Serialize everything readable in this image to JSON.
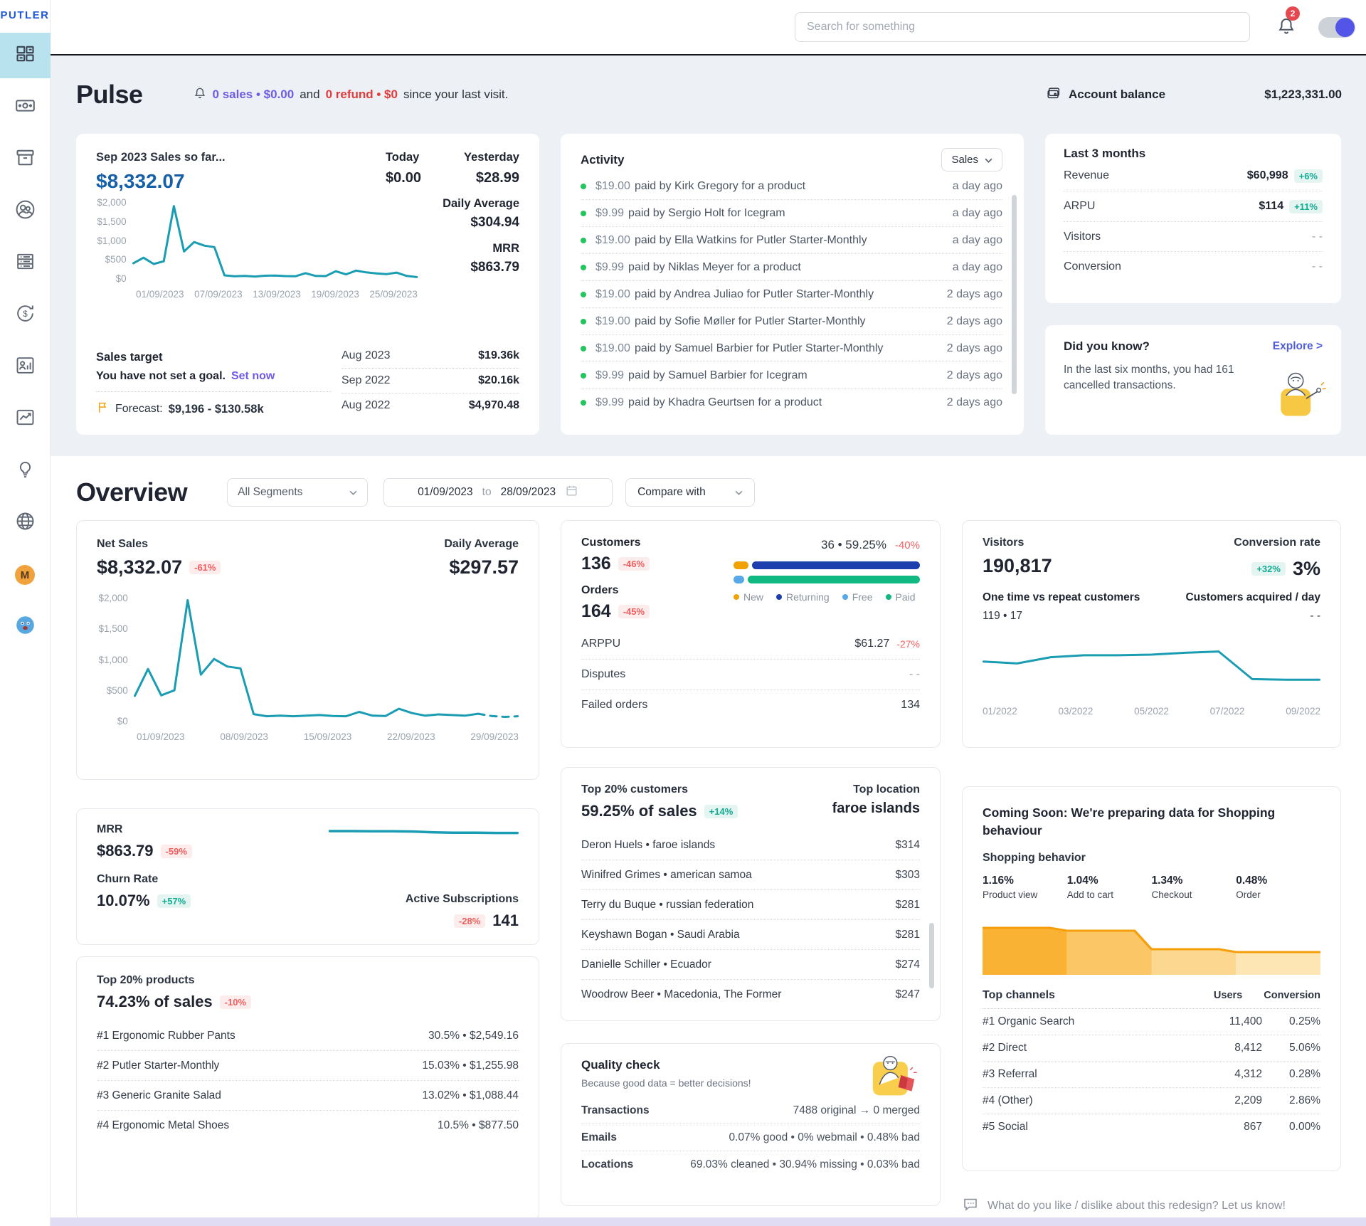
{
  "sidebar": {
    "logo": "PUTLER",
    "profile_initial": "M"
  },
  "topbar": {
    "search_placeholder": "Search for something",
    "notification_count": "2"
  },
  "pulse": {
    "title": "Pulse",
    "notice": {
      "sales": "0 sales • $0.00",
      "and": "and",
      "refund": "0 refund • $0",
      "suffix": "since your last visit."
    },
    "account_balance": {
      "label": "Account balance",
      "value": "$1,223,331.00"
    },
    "sales_card": {
      "title": "Sep 2023 Sales so far...",
      "amount": "$8,332.07",
      "today_label": "Today",
      "today_value": "$0.00",
      "yesterday_label": "Yesterday",
      "yesterday_value": "$28.99",
      "daily_avg_label": "Daily Average",
      "daily_avg_value": "$304.94",
      "mrr_label": "MRR",
      "mrr_value": "$863.79",
      "target_title": "Sales target",
      "target_text": "You have not set a goal.",
      "target_link": "Set now",
      "forecast_label": "Forecast:",
      "forecast_value": "$9,196 - $130.58k",
      "history": [
        {
          "label": "Aug 2023",
          "value": "$19.36k"
        },
        {
          "label": "Sep 2022",
          "value": "$20.16k"
        },
        {
          "label": "Aug 2022",
          "value": "$4,970.48"
        }
      ],
      "chart": {
        "type": "line",
        "ymax": 2000,
        "y_ticks": [
          "$2,000",
          "$1,500",
          "$1,000",
          "$500",
          "$0"
        ],
        "x_ticks": [
          "01/09/2023",
          "07/09/2023",
          "13/09/2023",
          "19/09/2023",
          "25/09/2023"
        ],
        "values": [
          420,
          560,
          400,
          470,
          1880,
          720,
          960,
          870,
          830,
          110,
          85,
          95,
          80,
          100,
          105,
          90,
          85,
          165,
          95,
          90,
          215,
          135,
          230,
          185,
          160,
          140,
          180,
          95,
          65
        ]
      }
    },
    "activity": {
      "title": "Activity",
      "filter_label": "Sales",
      "items": [
        {
          "amount": "$19.00",
          "text": "paid by Kirk Gregory for a product",
          "time": "a day ago"
        },
        {
          "amount": "$9.99",
          "text": "paid by Sergio Holt for Icegram",
          "time": "a day ago"
        },
        {
          "amount": "$19.00",
          "text": "paid by Ella Watkins for Putler Starter-Monthly",
          "time": "a day ago"
        },
        {
          "amount": "$9.99",
          "text": "paid by Niklas Meyer for a product",
          "time": "a day ago"
        },
        {
          "amount": "$19.00",
          "text": "paid by Andrea Juliao for Putler Starter-Monthly",
          "time": "2 days ago"
        },
        {
          "amount": "$19.00",
          "text": "paid by Sofie Møller for Putler Starter-Monthly",
          "time": "2 days ago"
        },
        {
          "amount": "$19.00",
          "text": "paid by Samuel Barbier for Putler Starter-Monthly",
          "time": "2 days ago"
        },
        {
          "amount": "$9.99",
          "text": "paid by Samuel Barbier for Icegram",
          "time": "2 days ago"
        },
        {
          "amount": "$9.99",
          "text": "paid by Khadra Geurtsen for a product",
          "time": "2 days ago"
        }
      ]
    },
    "last3": {
      "title": "Last 3 months",
      "rows": [
        {
          "label": "Revenue",
          "value": "$60,998",
          "change": "+6%"
        },
        {
          "label": "ARPU",
          "value": "$114",
          "change": "+11%"
        },
        {
          "label": "Visitors",
          "value": "- -"
        },
        {
          "label": "Conversion",
          "value": "- -"
        }
      ]
    },
    "didyouknow": {
      "title": "Did you know?",
      "link": "Explore >",
      "text": "In the last six months, you had 161 cancelled transactions."
    }
  },
  "overview": {
    "title": "Overview",
    "segments_label": "All Segments",
    "date_from": "01/09/2023",
    "date_join": "to",
    "date_to": "28/09/2023",
    "compare_label": "Compare with",
    "net_sales": {
      "title": "Net Sales",
      "amount": "$8,332.07",
      "change": "-61%",
      "daily_avg_label": "Daily Average",
      "daily_avg_value": "$297.57",
      "chart": {
        "type": "line",
        "ymax": 2000,
        "dashed_from": 26,
        "y_ticks": [
          "$2,000",
          "$1,500",
          "$1,000",
          "$500",
          "$0"
        ],
        "x_ticks": [
          "01/09/2023",
          "08/09/2023",
          "15/09/2023",
          "22/09/2023",
          "29/09/2023"
        ],
        "values": [
          420,
          850,
          430,
          510,
          1950,
          760,
          1010,
          890,
          860,
          130,
          95,
          105,
          95,
          105,
          115,
          100,
          95,
          165,
          105,
          100,
          215,
          145,
          105,
          125,
          115,
          105,
          135,
          100,
          85,
          95
        ]
      }
    },
    "mrr": {
      "title": "MRR",
      "amount": "$863.79",
      "change": "-59%",
      "churn_label": "Churn Rate",
      "churn_value": "10.07%",
      "churn_change": "+57%",
      "subs_label": "Active Subscriptions",
      "subs_change": "-28%",
      "subs_value": "141",
      "spark": {
        "type": "line",
        "ymax": 100,
        "values": [
          82,
          82,
          81,
          81,
          80,
          76,
          74,
          74,
          73,
          73
        ]
      }
    },
    "top_products": {
      "title": "Top 20% products",
      "share": "74.23% of sales",
      "change": "-10%",
      "rows": [
        {
          "name": "#1 Ergonomic Rubber Pants",
          "stats": "30.5% • $2,549.16"
        },
        {
          "name": "#2 Putler Starter-Monthly",
          "stats": "15.03% • $1,255.98"
        },
        {
          "name": "#3 Generic Granite Salad",
          "stats": "13.02% • $1,088.44"
        },
        {
          "name": "#4 Ergonomic Metal Shoes",
          "stats": "10.5% • $877.50"
        }
      ]
    },
    "customers": {
      "customers_label": "Customers",
      "customers_value": "136",
      "customers_change": "-46%",
      "orders_label": "Orders",
      "orders_value": "164",
      "orders_change": "-45%",
      "stat_line": "36 • 59.25%",
      "stat_change": "-40%",
      "bars": [
        {
          "segments": [
            {
              "color": "#f0a202",
              "w": 8
            },
            {
              "color": "#1d3fad",
              "w": 92
            }
          ]
        },
        {
          "segments": [
            {
              "color": "#57a8e9",
              "w": 6
            },
            {
              "color": "#10b981",
              "w": 94
            }
          ]
        }
      ],
      "legend": [
        {
          "label": "New",
          "color": "#f0a202"
        },
        {
          "label": "Returning",
          "color": "#1d3fad"
        },
        {
          "label": "Free",
          "color": "#57a8e9"
        },
        {
          "label": "Paid",
          "color": "#10b981"
        }
      ],
      "rows": [
        {
          "label": "ARPPU",
          "value": "$61.27",
          "change": "-27%"
        },
        {
          "label": "Disputes",
          "value": "- -"
        },
        {
          "label": "Failed orders",
          "value": "134"
        }
      ]
    },
    "top_customers": {
      "title": "Top 20% customers",
      "share": "59.25% of sales",
      "change": "+14%",
      "loc_label": "Top location",
      "loc_value": "faroe islands",
      "rows": [
        {
          "name": "Deron Huels • faroe islands",
          "value": "$314"
        },
        {
          "name": "Winifred Grimes • american samoa",
          "value": "$303"
        },
        {
          "name": "Terry du Buque • russian federation",
          "value": "$281"
        },
        {
          "name": "Keyshawn Bogan • Saudi Arabia",
          "value": "$281"
        },
        {
          "name": "Danielle Schiller • Ecuador",
          "value": "$274"
        },
        {
          "name": "Woodrow Beer • Macedonia, The Former",
          "value": "$247"
        }
      ]
    },
    "quality": {
      "title": "Quality check",
      "subtitle": "Because good data = better decisions!",
      "rows": [
        {
          "label": "Transactions",
          "value": "7488 original → 0 merged"
        },
        {
          "label": "Emails",
          "value": "0.07% good • 0% webmail • 0.48% bad"
        },
        {
          "label": "Locations",
          "value": "69.03% cleaned • 30.94% missing • 0.03% bad"
        }
      ]
    },
    "visitors": {
      "title": "Visitors",
      "value": "190,817",
      "conv_label": "Conversion rate",
      "conv_change": "+32%",
      "conv_value": "3%",
      "onetime_label": "One time vs repeat customers",
      "onetime_value": "119 • 17",
      "acq_label": "Customers acquired / day",
      "acq_value": "- -",
      "chart": {
        "type": "line",
        "ymax": 100,
        "x_ticks": [
          "01/2022",
          "03/2022",
          "05/2022",
          "07/2022",
          "09/2022"
        ],
        "values": [
          56,
          53,
          63,
          66,
          66,
          67,
          70,
          72,
          28,
          27,
          27
        ]
      }
    },
    "coming_soon": {
      "title": "Coming Soon: We're preparing data for Shopping behaviour",
      "behavior_label": "Shopping behavior",
      "funnel": [
        {
          "value": "1.16%",
          "label": "Product view",
          "bar": 66
        },
        {
          "value": "1.04%",
          "label": "Add to cart",
          "bar": 62
        },
        {
          "value": "1.34%",
          "label": "Checkout",
          "bar": 36
        },
        {
          "value": "0.48%",
          "label": "Order",
          "bar": 32
        }
      ],
      "channels": {
        "title": "Top channels",
        "users_label": "Users",
        "conv_label": "Conversion",
        "rows": [
          {
            "label": "#1 Organic Search",
            "users": "11,400",
            "conv": "0.25%"
          },
          {
            "label": "#2 Direct",
            "users": "8,412",
            "conv": "5.06%"
          },
          {
            "label": "#3 Referral",
            "users": "4,312",
            "conv": "0.28%"
          },
          {
            "label": "#4 (Other)",
            "users": "2,209",
            "conv": "2.86%"
          },
          {
            "label": "#5 Social",
            "users": "867",
            "conv": "0.00%"
          }
        ]
      }
    },
    "feedback": "What do you like / dislike about this redesign? Let us know!"
  },
  "colors": {
    "accent_teal": "#1a9db3",
    "accent_purple": "#6e5be6",
    "alert_red": "#e23b3b",
    "funnel_orange": "#f59f0b"
  }
}
